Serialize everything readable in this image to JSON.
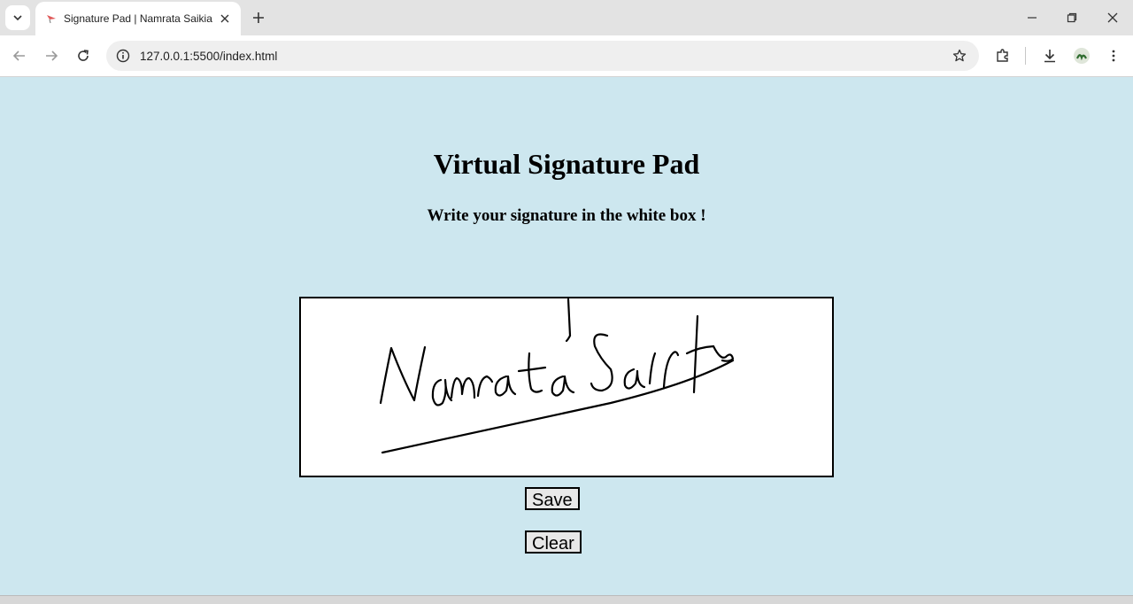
{
  "browser": {
    "tab_title": "Signature Pad | Namrata Saikia",
    "url": "127.0.0.1:5500/index.html"
  },
  "page": {
    "heading": "Virtual Signature Pad",
    "subheading": "Write your signature in the white box !",
    "save_label": "Save",
    "clear_label": "Clear"
  },
  "colors": {
    "page_background": "#cde7ef",
    "pad_background": "#ffffff",
    "ink": "#000000"
  }
}
